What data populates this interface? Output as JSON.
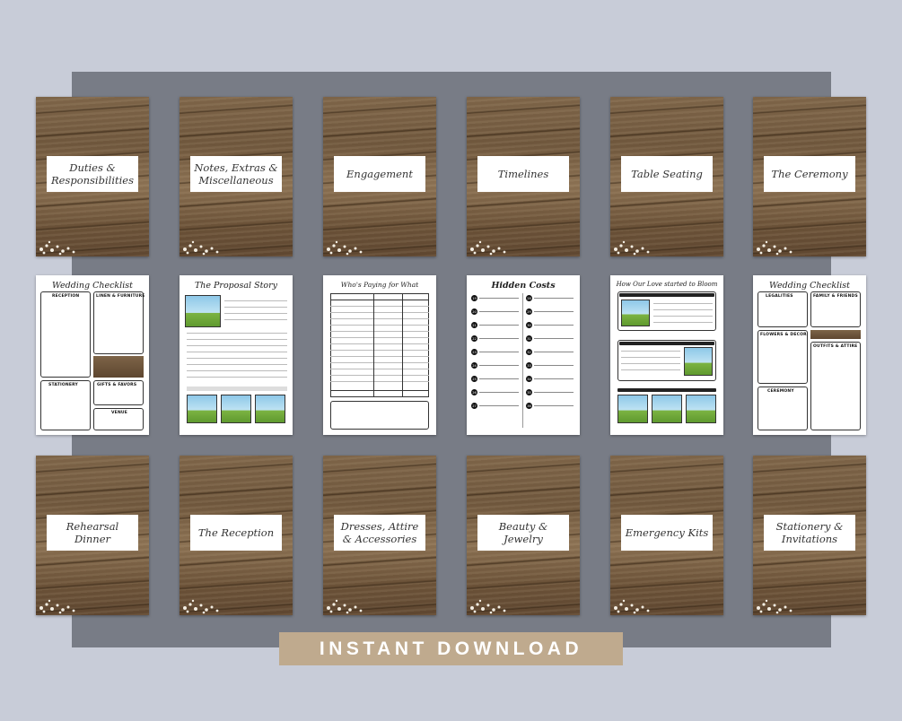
{
  "banner": {
    "text": "INSTANT DOWNLOAD"
  },
  "covers": [
    {
      "title": "Duties & Responsibilities"
    },
    {
      "title": "Notes, Extras & Miscellaneous"
    },
    {
      "title": "Engagement"
    },
    {
      "title": "Timelines"
    },
    {
      "title": "Table Seating"
    },
    {
      "title": "The Ceremony"
    },
    {
      "title": "Rehearsal Dinner"
    },
    {
      "title": "The Reception"
    },
    {
      "title": "Dresses, Attire & Accessories"
    },
    {
      "title": "Beauty & Jewelry"
    },
    {
      "title": "Emergency Kits"
    },
    {
      "title": "Stationery & Invitations"
    }
  ],
  "pages": {
    "checklist1": {
      "title": "Wedding Checklist",
      "sections": [
        "RECEPTION",
        "LINEN & FURNITURE",
        "STATIONERY",
        "GIFTS & FAVORS",
        "VENUE"
      ]
    },
    "proposal": {
      "title": "The Proposal Story"
    },
    "paying": {
      "title": "Who's Paying for What"
    },
    "hidden": {
      "title": "Hidden Costs"
    },
    "bloom": {
      "title": "How Our Love started to Bloom"
    },
    "checklist2": {
      "title": "Wedding Checklist",
      "sections": [
        "LEGALITIES",
        "FAMILY & FRIENDS",
        "FLOWERS & DECOR",
        "OUTFITS & ATTIRE",
        "CEREMONY"
      ]
    }
  }
}
